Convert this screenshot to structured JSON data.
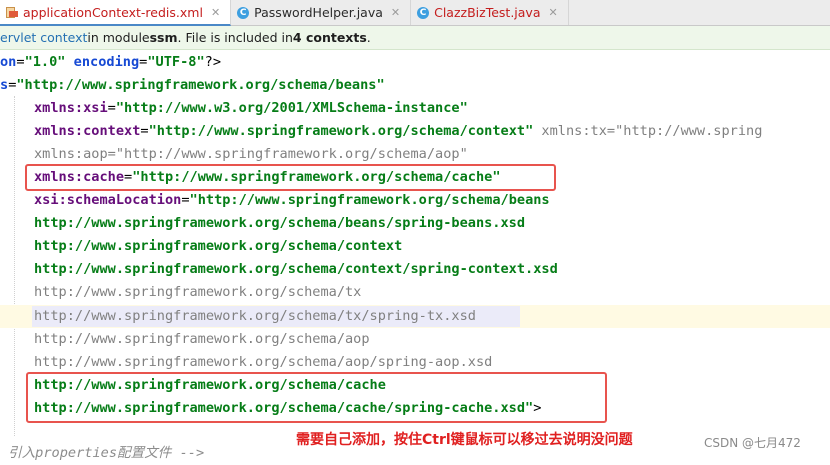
{
  "tabs": [
    {
      "label": "applicationContext-redis.xml",
      "icon": "xml-file-icon",
      "active": true
    },
    {
      "label": "PasswordHelper.java",
      "icon": "java-class-icon",
      "active": false
    },
    {
      "label": "ClazzBizTest.java",
      "icon": "java-class-icon",
      "active": false
    }
  ],
  "banner": {
    "link": "ervlet context",
    "mid": " in module ",
    "module": "ssm",
    "mid2": ". File is included in ",
    "count": "4 contexts",
    "end": "."
  },
  "code": {
    "l1": {
      "a": "on",
      "b": "=",
      "c": "\"1.0\"",
      "d": " encoding",
      "e": "=",
      "f": "\"UTF-8\"",
      "g": "?>"
    },
    "l2": {
      "a": "s",
      "b": "=",
      "c": "\"http://www.springframework.org/schema/beans\""
    },
    "l3": {
      "ns": "xmlns",
      "sep": ":",
      "name": "xsi",
      "eq": "=",
      "v": "\"http://www.w3.org/2001/XMLSchema-instance\""
    },
    "l4": {
      "ns": "xmlns",
      "sep": ":",
      "name": "context",
      "eq": "=",
      "v": "\"http://www.springframework.org/schema/context\"",
      "rest": " xmlns:tx=\"http://www.spring"
    },
    "l5": {
      "text": "xmlns:aop=\"http://www.springframework.org/schema/aop\""
    },
    "l6": {
      "ns": "xmlns",
      "sep": ":",
      "name": "cache",
      "eq": "=",
      "v": "\"http://www.springframework.org/schema/cache\""
    },
    "l7": {
      "ns": "xsi",
      "sep": ":",
      "name": "schemaLocation",
      "eq": "=",
      "v": "\"http://www.springframework.org/schema/beans"
    },
    "l8": "http://www.springframework.org/schema/beans/spring-beans.xsd",
    "l9": "http://www.springframework.org/schema/context",
    "l10": "http://www.springframework.org/schema/context/spring-context.xsd",
    "l11": "http://www.springframework.org/schema/tx",
    "l12": "http://www.springframework.org/schema/tx/spring-tx.xsd",
    "l13": "http://www.springframework.org/schema/aop",
    "l14": "http://www.springframework.org/schema/aop/spring-aop.xsd",
    "l15": "http://www.springframework.org/schema/cache",
    "l16": {
      "v": "http://www.springframework.org/schema/cache/spring-cache.xsd\"",
      "end": ">"
    },
    "l17": "引入properties配置文件 -->"
  },
  "annotation": "需要自己添加，按住Ctrl键鼠标可以移过去说明没问题",
  "watermark": "CSDN @七月472"
}
